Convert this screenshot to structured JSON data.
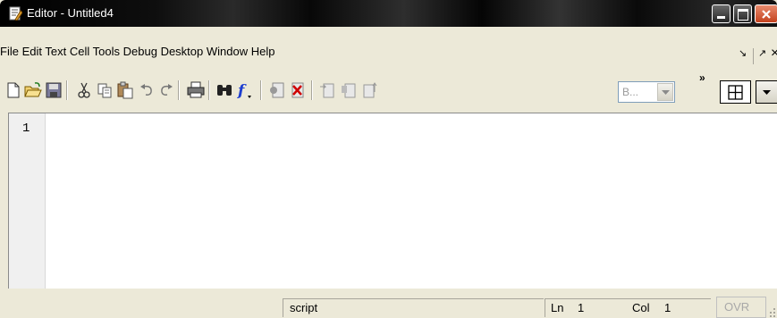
{
  "window": {
    "title": "Editor - Untitled4"
  },
  "menu": {
    "items": [
      "File",
      "Edit",
      "Text",
      "Cell",
      "Tools",
      "Debug",
      "Desktop",
      "Window",
      "Help"
    ],
    "undock_glyph": "↘",
    "maximize_glyph": "↗",
    "close_glyph": "×"
  },
  "toolbar": {
    "cell_combo_value": "B...",
    "more_chevron": "»"
  },
  "editor": {
    "line_numbers": [
      "1"
    ]
  },
  "status": {
    "file_type": "script",
    "ln_label": "Ln",
    "ln_value": "1",
    "col_label": "Col",
    "col_value": "1",
    "ovr": "OVR"
  },
  "colors": {
    "chrome": "#ece9d8",
    "close_button": "#c4421e",
    "function_icon": "#1e3fd0",
    "delete_icon": "#d00000"
  }
}
